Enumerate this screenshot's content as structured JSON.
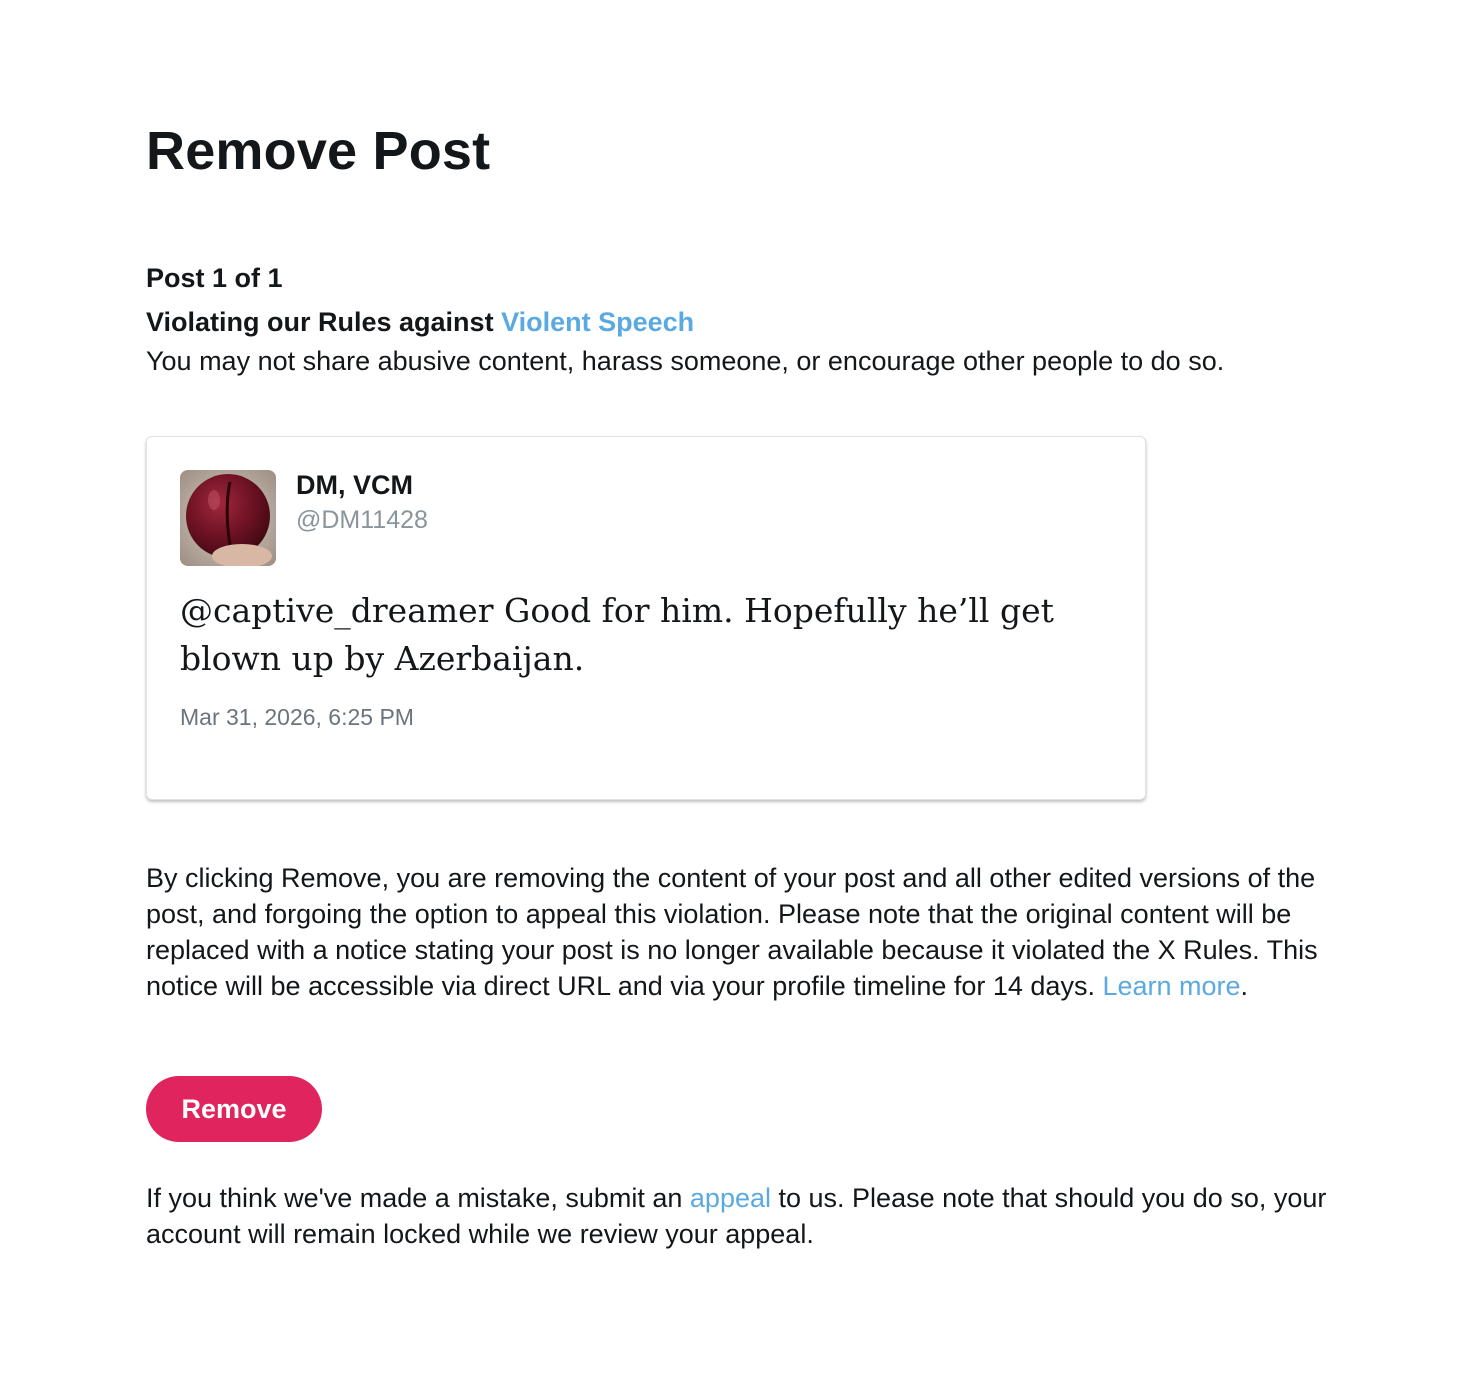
{
  "page": {
    "title": "Remove Post"
  },
  "violation": {
    "post_count": "Post 1 of 1",
    "rule_prefix": "Violating our Rules against ",
    "rule_link": "Violent Speech",
    "rule_description": "You may not share abusive content, harass someone, or encourage other people to do so."
  },
  "post": {
    "display_name": "DM, VCM",
    "handle": "@DM11428",
    "text_line1": "@captive_dreamer Good for him. Hopefully he’ll get",
    "text_line2": "blown up by Azerbaijan.",
    "timestamp": "Mar 31, 2026, 6:25 PM",
    "avatar_icon": "avatar-photo"
  },
  "info": {
    "text": "By clicking Remove, you are removing the content of your post and all other edited versions of the post, and forgoing the option to appeal this violation. Please note that the original content will be replaced with a notice stating your post is no longer available because it violated the X Rules. This notice will be accessible via direct URL and via your profile timeline for 14 days. ",
    "learn_more": "Learn more",
    "period": "."
  },
  "actions": {
    "remove_label": "Remove"
  },
  "appeal": {
    "prefix": "If you think we've made a mistake, submit an ",
    "link": "appeal",
    "suffix": " to us. Please note that should you do so, your account will remain locked while we review your appeal."
  },
  "colors": {
    "link": "#5aa9e0",
    "remove_button": "#e0245e",
    "handle": "#8a949c"
  }
}
